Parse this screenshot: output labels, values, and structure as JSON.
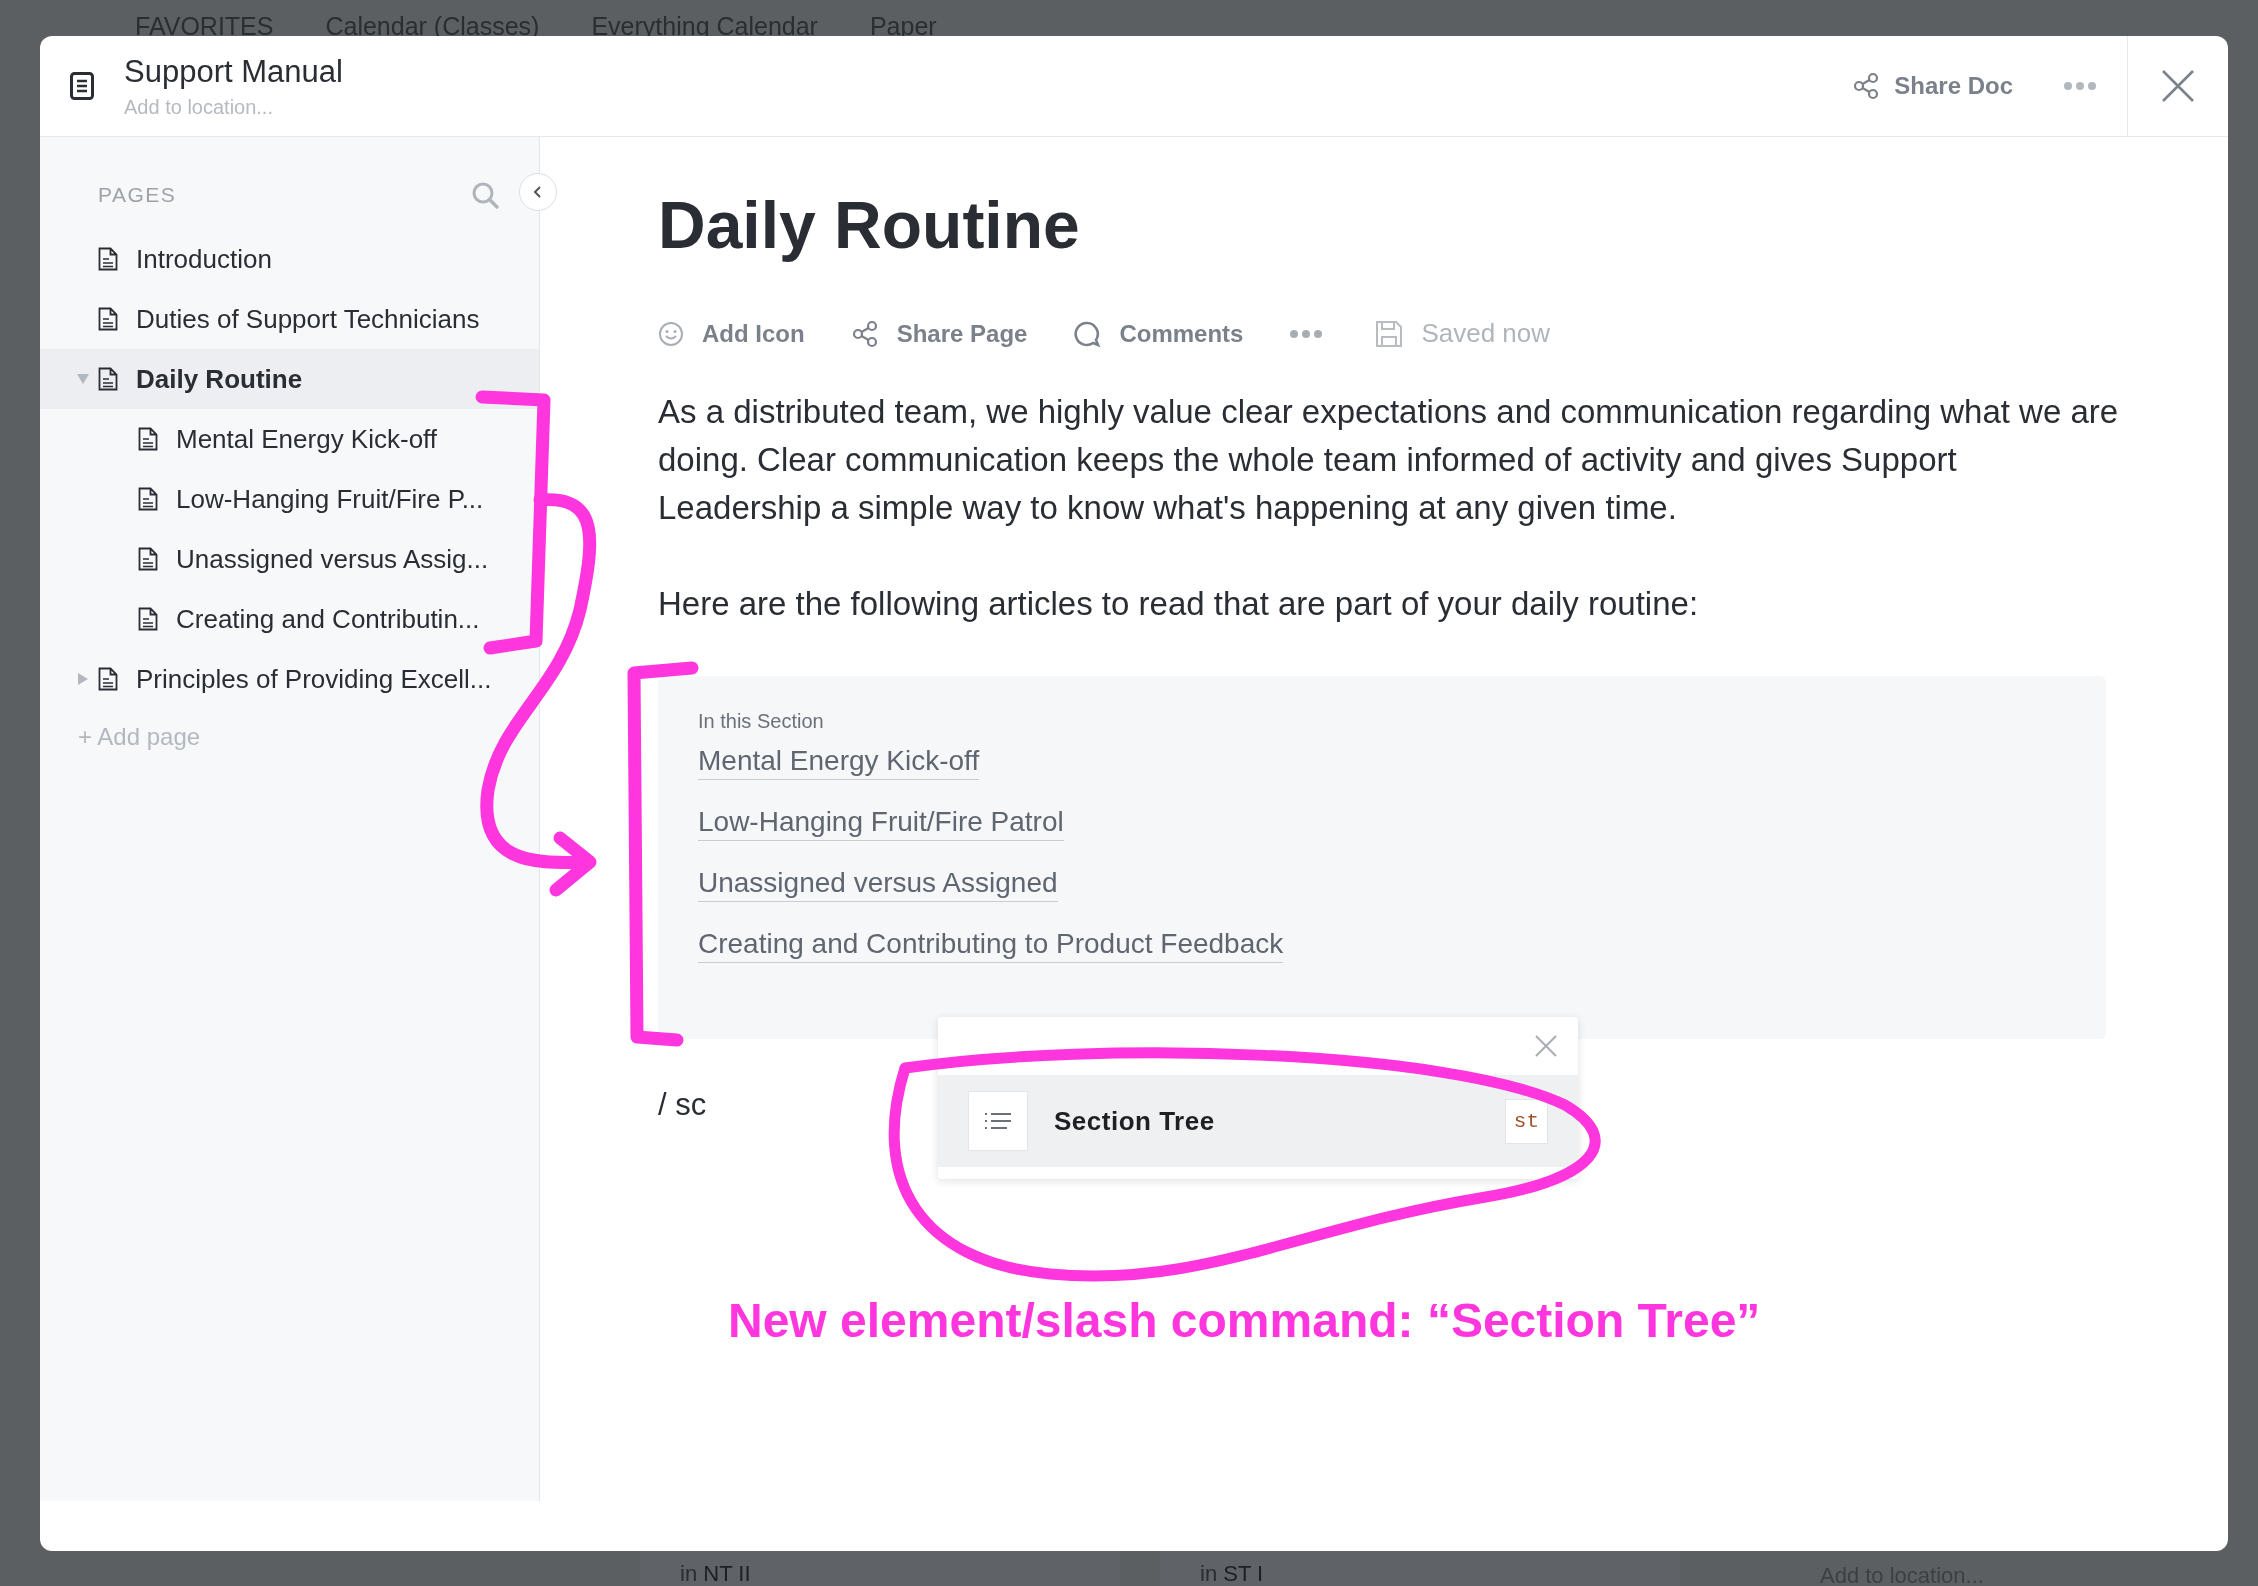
{
  "background": {
    "tabs": [
      "FAVORITES",
      "Calendar (Classes)",
      "Everything Calendar",
      "Paper"
    ],
    "cards": [
      {
        "prefix": "in",
        "location": "NT II"
      },
      {
        "prefix": "in",
        "location": "ST I"
      }
    ],
    "location_hint": "Add to location..."
  },
  "modal": {
    "title": "Support Manual",
    "location_placeholder": "Add to location...",
    "share_label": "Share Doc"
  },
  "sidebar": {
    "heading": "PAGES",
    "add_label": "+ Add page",
    "pages": [
      {
        "title": "Introduction",
        "kind": "page",
        "selected": false
      },
      {
        "title": "Duties of Support Technicians",
        "kind": "page",
        "selected": false
      },
      {
        "title": "Daily Routine",
        "kind": "folder",
        "expanded": true,
        "selected": true,
        "children": [
          {
            "title": "Mental Energy Kick-off",
            "selected": false
          },
          {
            "title": "Low-Hanging Fruit/Fire P...",
            "selected": false
          },
          {
            "title": "Unassigned versus Assig...",
            "selected": false
          },
          {
            "title": "Creating and Contributin...",
            "selected": false
          }
        ]
      },
      {
        "title": "Principles of Providing Excell...",
        "kind": "folder",
        "expanded": false,
        "selected": false
      }
    ]
  },
  "document": {
    "title": "Daily Routine",
    "toolbar": [
      {
        "label": "Add Icon",
        "kind": "smiley"
      },
      {
        "label": "Share Page",
        "kind": "share"
      },
      {
        "label": "Comments",
        "kind": "comment"
      },
      {
        "kind": "more"
      },
      {
        "label": "Saved now",
        "kind": "saved"
      }
    ],
    "paragraphs": [
      "As a distributed team, we highly value clear expectations and communication regarding what we are doing. Clear communication keeps the whole team informed of activity and gives Support Leadership a simple way to know what's happening at any given time.",
      "Here are the following articles to read that are part of your daily routine:"
    ],
    "section_tree": {
      "heading": "In this Section",
      "links": [
        "Mental Energy Kick-off",
        "Low-Hanging Fruit/Fire Patrol",
        "Unassigned versus Assigned",
        "Creating and Contributing to Product Feedback"
      ]
    },
    "editor_value": "/ sc",
    "command_menu": {
      "items": [
        {
          "label": "Section Tree",
          "shortcut": "st",
          "selected": true
        }
      ]
    }
  },
  "annotation": {
    "text": "New element/slash command: “Section Tree”"
  }
}
